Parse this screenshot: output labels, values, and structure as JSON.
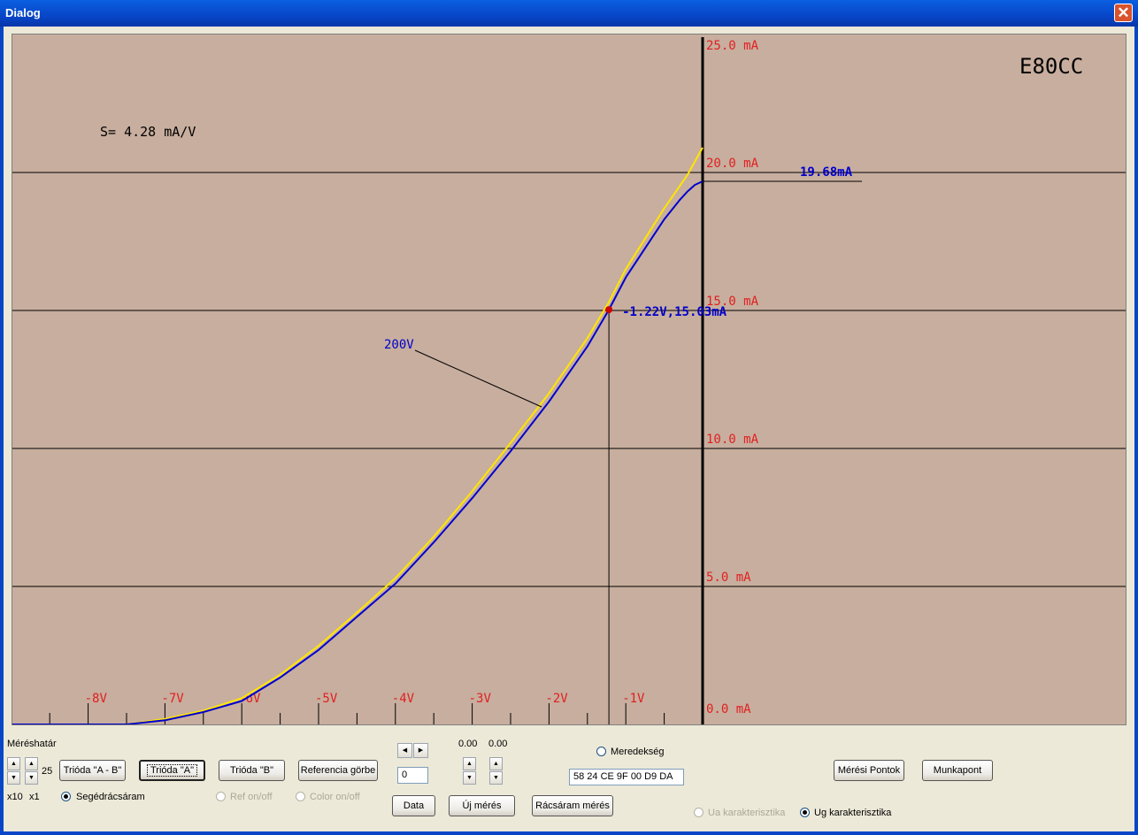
{
  "window": {
    "title": "Dialog"
  },
  "chart_data": {
    "type": "line",
    "title": "E80CC",
    "annotation_slope": "S= 4.28 mA/V",
    "xlim": [
      -9,
      0
    ],
    "ylim": [
      0,
      25
    ],
    "x_ticks": [
      "-8V",
      "-7V",
      "-6V",
      "-5V",
      "-4V",
      "-3V",
      "-2V",
      "-1V"
    ],
    "x_tick_values": [
      -8,
      -7,
      -6,
      -5,
      -4,
      -3,
      -2,
      -1
    ],
    "y_ticks": [
      "0.0 mA",
      "5.0 mA",
      "10.0 mA",
      "15.0 mA",
      "20.0 mA",
      "25.0 mA"
    ],
    "y_tick_values": [
      0,
      5,
      10,
      15,
      20,
      25
    ],
    "grid": true,
    "series": [
      {
        "name": "200V",
        "color": "#0000CC",
        "x": [
          -9.0,
          -7.5,
          -7.0,
          -6.5,
          -6.0,
          -5.5,
          -5.0,
          -4.5,
          -4.0,
          -3.5,
          -3.0,
          -2.5,
          -2.0,
          -1.5,
          -1.22,
          -1.0,
          -0.5,
          -0.3,
          -0.2,
          -0.1,
          0.0
        ],
        "y": [
          0.0,
          0.0,
          0.15,
          0.45,
          0.85,
          1.7,
          2.7,
          3.9,
          5.1,
          6.6,
          8.2,
          9.9,
          11.7,
          13.7,
          15.03,
          16.2,
          18.3,
          19.0,
          19.3,
          19.55,
          19.68
        ]
      },
      {
        "name": "reference",
        "color": "#FFE600",
        "x": [
          -9.0,
          -7.5,
          -7.0,
          -6.5,
          -6.0,
          -5.5,
          -5.0,
          -4.5,
          -4.0,
          -3.5,
          -3.0,
          -2.5,
          -2.0,
          -1.5,
          -1.22,
          -1.0,
          -0.5,
          -0.2,
          0.0
        ],
        "y": [
          0.0,
          0.0,
          0.2,
          0.5,
          0.95,
          1.8,
          2.85,
          4.05,
          5.3,
          6.8,
          8.45,
          10.2,
          12.0,
          14.0,
          15.3,
          16.5,
          18.7,
          19.9,
          20.9
        ]
      }
    ],
    "series_label": "200V",
    "end_label": "19.68mA",
    "end_value": 19.68,
    "marker": {
      "x": -1.22,
      "y": 15.03,
      "label": "-1.22V,15.03mA",
      "color": "#CC0000"
    },
    "colors": {
      "background": "#C8AE9E",
      "tick_labels": "#E02020",
      "curve": "#0000CC",
      "reference": "#FFE600"
    }
  },
  "controls": {
    "range_label": "Méréshatár",
    "range_value": "25",
    "x10_label": "x10",
    "x1_label": "x1",
    "btn_trioda_ab": "Trióda \"A - B\"",
    "btn_trioda_a": "Trióda  \"A\"",
    "btn_trioda_b": "Trióda  \"B\"",
    "btn_referencia": "Referencia görbe",
    "segedracsaram_label": "Segédrácsáram",
    "ref_onoff_label": "Ref on/off",
    "color_onoff_label": "Color on/off",
    "stepper_value": "0",
    "btn_data": "Data",
    "btn_uj_meres": "Új mérés",
    "value_1": "0.00",
    "value_2": "0.00",
    "btn_racsaram": "Rácsáram mérés",
    "meredekseg_label": "Meredekség",
    "hex_field": "58  24 CE 9F 00 D9 DA",
    "ua_label": "Ua karakterisztika",
    "ug_label": "Ug karakterisztika",
    "btn_meresi_pontok": "Mérési Pontok",
    "btn_munkapont": "Munkapont"
  }
}
